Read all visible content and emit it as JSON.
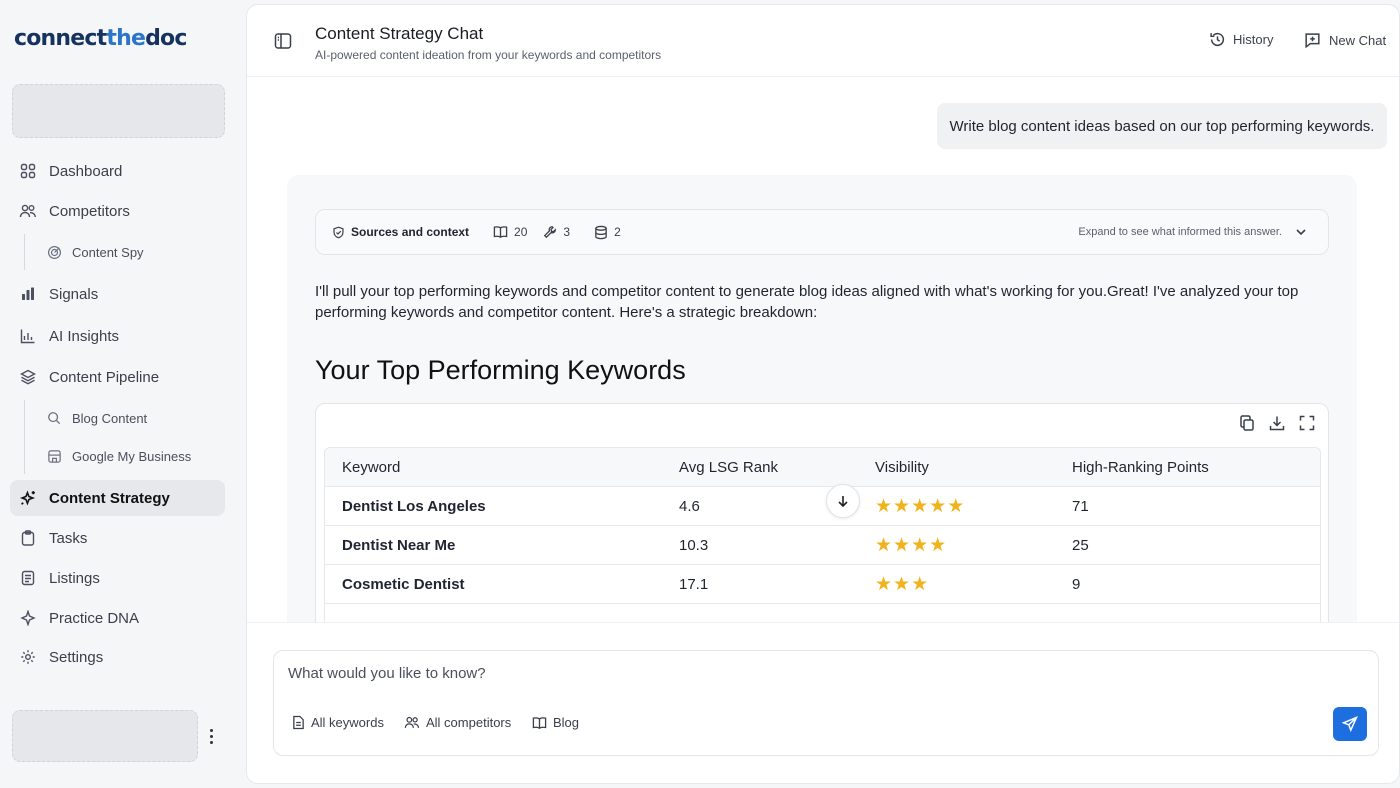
{
  "brand": {
    "part1": "connect",
    "part2": "the",
    "part3": "doc"
  },
  "sidebar": {
    "items": [
      {
        "label": "Dashboard",
        "icon": "grid-icon"
      },
      {
        "label": "Competitors",
        "icon": "users-icon"
      },
      {
        "label": "Content Spy",
        "icon": "radar-icon",
        "sub": true
      },
      {
        "label": "Signals",
        "icon": "bar-chart-icon"
      },
      {
        "label": "AI Insights",
        "icon": "chart-icon"
      },
      {
        "label": "Content Pipeline",
        "icon": "layers-icon"
      },
      {
        "label": "Blog Content",
        "icon": "search-icon",
        "sub": true
      },
      {
        "label": "Google My Business",
        "icon": "store-icon",
        "sub": true
      },
      {
        "label": "Content Strategy",
        "icon": "sparkle-icon",
        "active": true
      },
      {
        "label": "Tasks",
        "icon": "clipboard-icon"
      },
      {
        "label": "Listings",
        "icon": "document-icon"
      },
      {
        "label": "Practice DNA",
        "icon": "dna-icon"
      },
      {
        "label": "Settings",
        "icon": "gear-icon"
      }
    ]
  },
  "header": {
    "title": "Content Strategy Chat",
    "subtitle": "AI-powered content ideation from your keywords and competitors",
    "history_label": "History",
    "new_chat_label": "New Chat"
  },
  "chat": {
    "user_message": "Write blog content ideas based on our top performing keywords.",
    "sources": {
      "label": "Sources and context",
      "books_count": "20",
      "tools_count": "3",
      "db_count": "2",
      "hint": "Expand to see what informed this answer."
    },
    "answer_text": "I'll pull your top performing keywords and competitor content to generate blog ideas aligned with what's working for you.Great! I've analyzed your top performing keywords and competitor content. Here's a strategic breakdown:",
    "heading": "Your Top Performing Keywords",
    "table": {
      "headers": [
        "Keyword",
        "Avg LSG Rank",
        "Visibility",
        "High-Ranking Points"
      ],
      "rows": [
        {
          "keyword": "Dentist Los Angeles",
          "rank": "4.6",
          "stars": 5,
          "points": "71"
        },
        {
          "keyword": "Dentist Near Me",
          "rank": "10.3",
          "stars": 4,
          "points": "25"
        },
        {
          "keyword": "Cosmetic Dentist",
          "rank": "17.1",
          "stars": 3,
          "points": "9"
        }
      ]
    }
  },
  "composer": {
    "placeholder": "What would you like to know?",
    "chips": [
      "All keywords",
      "All competitors",
      "Blog"
    ]
  },
  "colors": {
    "accent": "#1d6fe0",
    "star": "#f2b21b",
    "brand_dark": "#16335f",
    "brand_light": "#2c74c9"
  }
}
